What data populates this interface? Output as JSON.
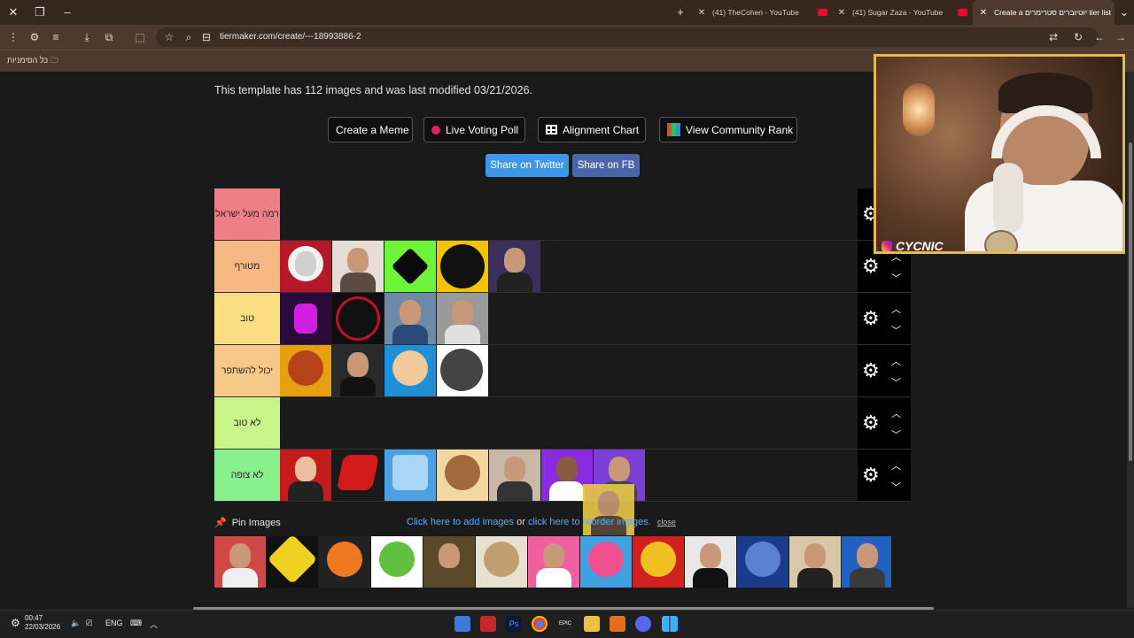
{
  "browser": {
    "tabs": [
      {
        "label": "(41) TheCohen - YouTube"
      },
      {
        "label": "(41) Sugar Zaza - YouTube"
      },
      {
        "label": "Create a יוטיוברים סטרימרים tier list"
      }
    ],
    "new_tab_symbol": "+",
    "url": "tiermaker.com/create/---18993886-2",
    "bookmarks_folder": "כל הסימניות"
  },
  "page": {
    "info_text": "This template has 112 images and was last modified 03/21/2026.",
    "buttons": {
      "create_meme": "Create a Meme",
      "live_poll": "Live Voting Poll",
      "alignment_chart": "Alignment Chart",
      "community_rank": "View Community Rank",
      "share_twitter": "Share on Twitter",
      "share_fb": "Share on FB"
    },
    "tiers": [
      {
        "label": "רמה מעל ישראל",
        "color": "#ef7f86",
        "items": 0
      },
      {
        "label": "מטורף",
        "color": "#f7b983",
        "items": 5
      },
      {
        "label": "טוב",
        "color": "#fbdd84",
        "items": 4
      },
      {
        "label": "יכול להשתפר",
        "color": "#f7c988",
        "items": 4
      },
      {
        "label": "לא טוב",
        "color": "#c8f48a",
        "items": 0
      },
      {
        "label": "לא צופה",
        "color": "#88f08c",
        "items": 7
      }
    ],
    "pin_label": "Pin Images",
    "help": {
      "link1": "Click here to add images",
      "or": "or",
      "link2": "click here to reorder images.",
      "close": "close"
    }
  },
  "webcam": {
    "tag": "CYCNIC"
  },
  "taskbar": {
    "time": "00:47",
    "date": "22/03/2026",
    "language": "ENG"
  }
}
